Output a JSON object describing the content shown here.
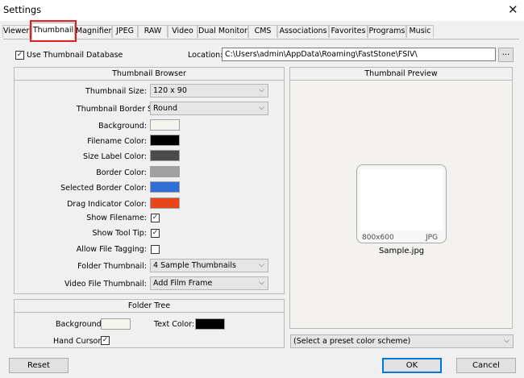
{
  "window": {
    "title": "Settings",
    "close_glyph": "✕"
  },
  "tabs": [
    {
      "label": "Viewer"
    },
    {
      "label": "Thumbnail"
    },
    {
      "label": "Magnifier"
    },
    {
      "label": "JPEG"
    },
    {
      "label": "RAW"
    },
    {
      "label": "Video"
    },
    {
      "label": "Dual Monitor"
    },
    {
      "label": "CMS"
    },
    {
      "label": "Associations"
    },
    {
      "label": "Favorites"
    },
    {
      "label": "Programs"
    },
    {
      "label": "Music"
    }
  ],
  "active_tab": "Thumbnail",
  "top": {
    "use_db_label": "Use Thumbnail Database",
    "use_db_checked": "✓",
    "location_label": "Location:",
    "location_value": "C:\\Users\\admin\\AppData\\Roaming\\FastStone\\FSIV\\",
    "browse_label": "..."
  },
  "browser": {
    "header": "Thumbnail Browser",
    "size_label": "Thumbnail Size:",
    "size_value": "120 x 90",
    "border_shape_label": "Thumbnail Border Shape:",
    "border_shape_value": "Round",
    "background_label": "Background:",
    "filename_color_label": "Filename Color:",
    "size_label_color_label": "Size Label Color:",
    "border_color_label": "Border Color:",
    "selected_border_label": "Selected Border Color:",
    "drag_indicator_label": "Drag Indicator Color:",
    "show_filename_label": "Show Filename:",
    "show_tooltip_label": "Show Tool Tip:",
    "allow_tagging_label": "Allow File Tagging:",
    "folder_thumb_label": "Folder Thumbnail:",
    "folder_thumb_value": "4 Sample Thumbnails",
    "video_thumb_label": "Video File Thumbnail:",
    "video_thumb_value": "Add Film Frame",
    "checkmark": "✓"
  },
  "colors": {
    "background": "#f5f5f0",
    "filename": "#000000",
    "size_label": "#4b4b4b",
    "border": "#a0a0a0",
    "selected_border": "#2f6fd6",
    "drag_indicator": "#e8461a",
    "tree_background": "#f5f5f0",
    "tree_text": "#000000"
  },
  "folder_tree": {
    "header": "Folder Tree",
    "background_label": "Background:",
    "text_color_label": "Text Color:",
    "hand_cursor_label": "Hand Cursor:",
    "hand_cursor_checked": "✓"
  },
  "preview": {
    "header": "Thumbnail Preview",
    "dimensions": "800x600",
    "format": "JPG",
    "filename": "Sample.jpg",
    "scheme_value": "(Select a preset color scheme)"
  },
  "footer": {
    "reset_label": "Reset",
    "ok_label": "OK",
    "cancel_label": "Cancel"
  },
  "icons": {
    "chevron": "⌵"
  }
}
